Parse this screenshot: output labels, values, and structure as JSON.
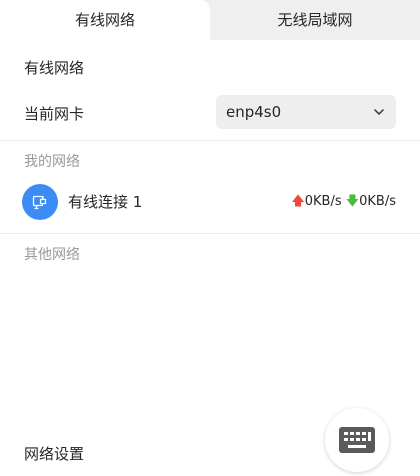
{
  "tabs": [
    {
      "label": "有线网络",
      "active": true
    },
    {
      "label": "无线局域网",
      "active": false
    }
  ],
  "wired": {
    "section_title": "有线网络",
    "nic_label": "当前网卡",
    "nic_selected": "enp4s0"
  },
  "my_networks": {
    "title": "我的网络",
    "items": [
      {
        "name": "有线连接 1",
        "icon": "ethernet-connection-icon",
        "upload": "0KB/s",
        "download": "0KB/s"
      }
    ]
  },
  "other_networks": {
    "title": "其他网络"
  },
  "footer": {
    "settings_label": "网络设置",
    "keyboard_icon": "keyboard-icon"
  },
  "colors": {
    "accent": "#3b8cf5",
    "upload_arrow": "#f0473a",
    "download_arrow": "#4cbc3f"
  }
}
